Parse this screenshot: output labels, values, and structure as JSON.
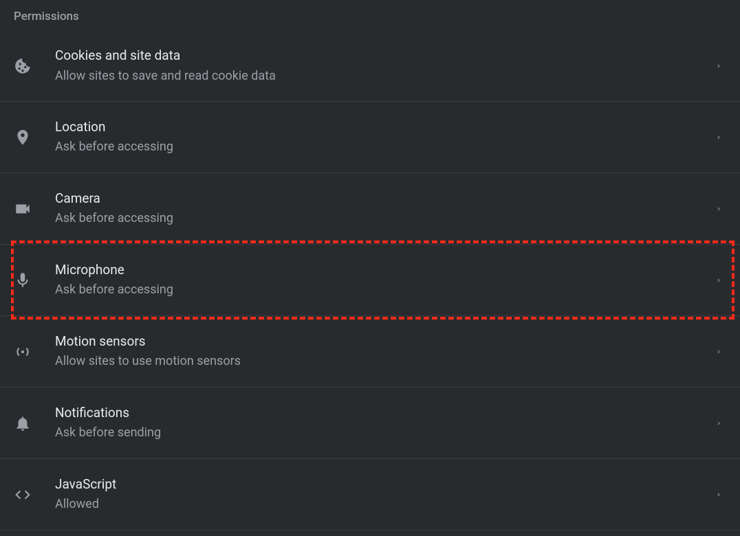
{
  "section_title": "Permissions",
  "permissions": [
    {
      "id": "cookies",
      "title": "Cookies and site data",
      "subtitle": "Allow sites to save and read cookie data",
      "icon": "cookie-icon",
      "highlighted": false
    },
    {
      "id": "location",
      "title": "Location",
      "subtitle": "Ask before accessing",
      "icon": "location-icon",
      "highlighted": false
    },
    {
      "id": "camera",
      "title": "Camera",
      "subtitle": "Ask before accessing",
      "icon": "camera-icon",
      "highlighted": false
    },
    {
      "id": "microphone",
      "title": "Microphone",
      "subtitle": "Ask before accessing",
      "icon": "microphone-icon",
      "highlighted": true
    },
    {
      "id": "motion",
      "title": "Motion sensors",
      "subtitle": "Allow sites to use motion sensors",
      "icon": "sensors-icon",
      "highlighted": false
    },
    {
      "id": "notifications",
      "title": "Notifications",
      "subtitle": "Ask before sending",
      "icon": "bell-icon",
      "highlighted": false
    },
    {
      "id": "javascript",
      "title": "JavaScript",
      "subtitle": "Allowed",
      "icon": "code-icon",
      "highlighted": false
    }
  ]
}
